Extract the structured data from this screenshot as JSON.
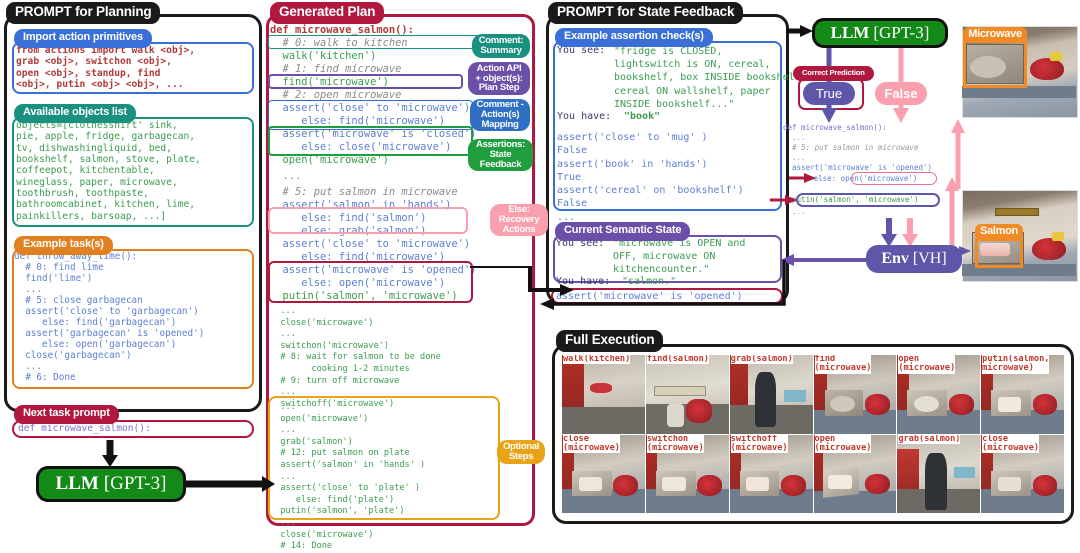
{
  "sections": {
    "prompt_planning": "PROMPT for Planning",
    "generated_plan": "Generated Plan",
    "prompt_state_feedback": "PROMPT for State Feedback",
    "full_execution": "Full Execution"
  },
  "planning": {
    "import_title": "Import action primitives",
    "import_code": "from actions import walk <obj>,\ngrab <obj>, switchon <obj>,\nopen <obj>, standup, find\n<obj>, putin <obj> <obj>, ...",
    "objects_title": "Available objects list",
    "objects_code": "objects=[clothesshirt' sink,\npie, apple, fridge, garbagecan,\ntv, dishwashingliquid, bed,\nbookshelf, salmon, stove, plate,\ncoffeepot, kitchentable,\nwineglass, paper, microwave,\ntoothbrush, toothpaste,\nbathroomcabinet, kitchen, lime,\npainkillers, barsoap, ...]",
    "example_title": "Example task(s)",
    "example_code": "def throw_away_lime():\n  # 0: find lime\n  find('lime')\n  ...\n  # 5: close garbagecan\n  assert('close' to 'garbagecan')\n     else: find('garbagecan')\n  assert('garbagecan' is 'opened')\n     else: open('garbagecan')\n  close('garbagecan')\n  ...\n  # 6: Done",
    "next_task_title": "Next task prompt",
    "next_task_code": "def microwave_salmon():"
  },
  "llm_left": {
    "label": "LLM",
    "model": "[GPT-3]"
  },
  "llm_right": {
    "label": "LLM",
    "model": "[GPT-3]"
  },
  "env": {
    "label": "Env",
    "model": "[VH]"
  },
  "plan": {
    "line_def": "def microwave_salmon():",
    "line_c0": "  # 0: walk to kitchen",
    "line_walk": "  walk('kitchen')",
    "line_c1": "  # 1: find microwave",
    "line_find": "  find('microwave')",
    "line_c2": "  # 2: open microwave",
    "line_a1": "  assert('close' to 'microwave')",
    "line_a1e": "     else: find('microwave')",
    "line_a2": "  assert('microwave' is 'closed')",
    "line_a2e": "     else: close('microwave')",
    "line_open": "  open('microwave')",
    "line_dots1": "  ...",
    "line_c5": "  # 5: put salmon in microwave",
    "line_a3": "  assert('salmon' in 'hands')",
    "line_a3e1": "     else: find('salmon')",
    "line_a3e2": "     else: grab('salmon')",
    "line_a4": "  assert('close' to 'microwave')",
    "line_a4e": "     else: find('microwave')",
    "line_a5": "  assert('microwave' is 'opened')",
    "line_a5e": "     else: open('microwave')",
    "line_putin": "  putin('salmon', 'microwave')",
    "tail": "  ...\n  close('microwave')\n  ...\n  switchon('microwave')\n  # 8: wait for salmon to be done\n        cooking 1-2 minutes\n  # 9: turn off microwave\n  ...\n  switchoff('microwave')",
    "optional": "  ...\n  open('microwave')\n  ...\n  grab('salmon')\n  # 12: put salmon on plate\n  assert('salmon' in 'hands' )\n  ...\n  assert('close' to 'plate' )\n     else: find('plate')\n  putin('salmon', 'plate')\n  ...\n  close('microwave')\n  # 14: Done"
  },
  "annotations": {
    "comment_summary": "Comment:\nSummary",
    "action_api": "Action API\n+ object(s):\nPlan Step",
    "comment_action": "Comment -\nAction(s)\nMapping",
    "assertions": "Assertions:\nState\nFeedback",
    "else_recovery": "Else:\nRecovery\nActions",
    "optional_steps": "Optional\nSteps"
  },
  "feedback": {
    "assertion_title": "Example assertion check(s)",
    "see_label": "You see:",
    "see_text": "\"fridge is CLOSED,\nlightswitch is ON, cereal,\nbookshelf, box INSIDE bookshelf,\ncereal ON wallshelf, paper\nINSIDE bookshelf...\"",
    "have_label": "You have:",
    "have_text": "\"book\"",
    "checks": "assert('close' to 'mug' )\nFalse\nassert('book' in 'hands')\nTrue\nassert('cereal' on 'bookshelf')\nFalse\n...",
    "state_title": "Current Semantic State",
    "state_see_label": "You see:",
    "state_see_text": "\"microwave is OPEN and\nOFF, microwave ON\nkitchencounter.\"",
    "state_have_label": "You have:",
    "state_have_text": "\"salmon.\"",
    "assert_out": "assert('microwave' is 'opened')"
  },
  "prediction": {
    "correct_label": "Correct Prediction",
    "true_label": "True",
    "false_label": "False"
  },
  "right_code": {
    "l1": "def microwave_salmon():",
    "l2": "  ...",
    "l3": "  # 5: put salmon in microwave",
    "l4": "  ...",
    "l5": "  assert('microwave' is 'opened')",
    "l6": "     else: open('microwave')",
    "l7": "  putin('salmon', 'microwave')",
    "l8": "  ..."
  },
  "vh_images": {
    "microwave_label": "Microwave",
    "salmon_label": "Salmon"
  },
  "execution": {
    "row1": [
      "walk(kitchen)",
      "find(salmon)",
      "grab(salmon)",
      "find\n(microwave)",
      "open\n(microwave)",
      "putin(salmon,\nmicrowave)"
    ],
    "row2": [
      "close\n(microwave)",
      "switchon\n(microwave)",
      "switchoff\n(microwave)",
      "open\n(microwave)",
      "grab(salmon)",
      "close\n(microwave)"
    ]
  },
  "colors": {
    "crimson": "#b01840",
    "teal": "#1a9080",
    "purple": "#6b4fa8",
    "blue": "#2f6fc4",
    "green": "#1f9d3f",
    "pink": "#f99fae",
    "orange": "#e8a317",
    "darkgreen": "#1a7a22",
    "slate": "#5a4fa0",
    "steel": "#5e56a8"
  }
}
